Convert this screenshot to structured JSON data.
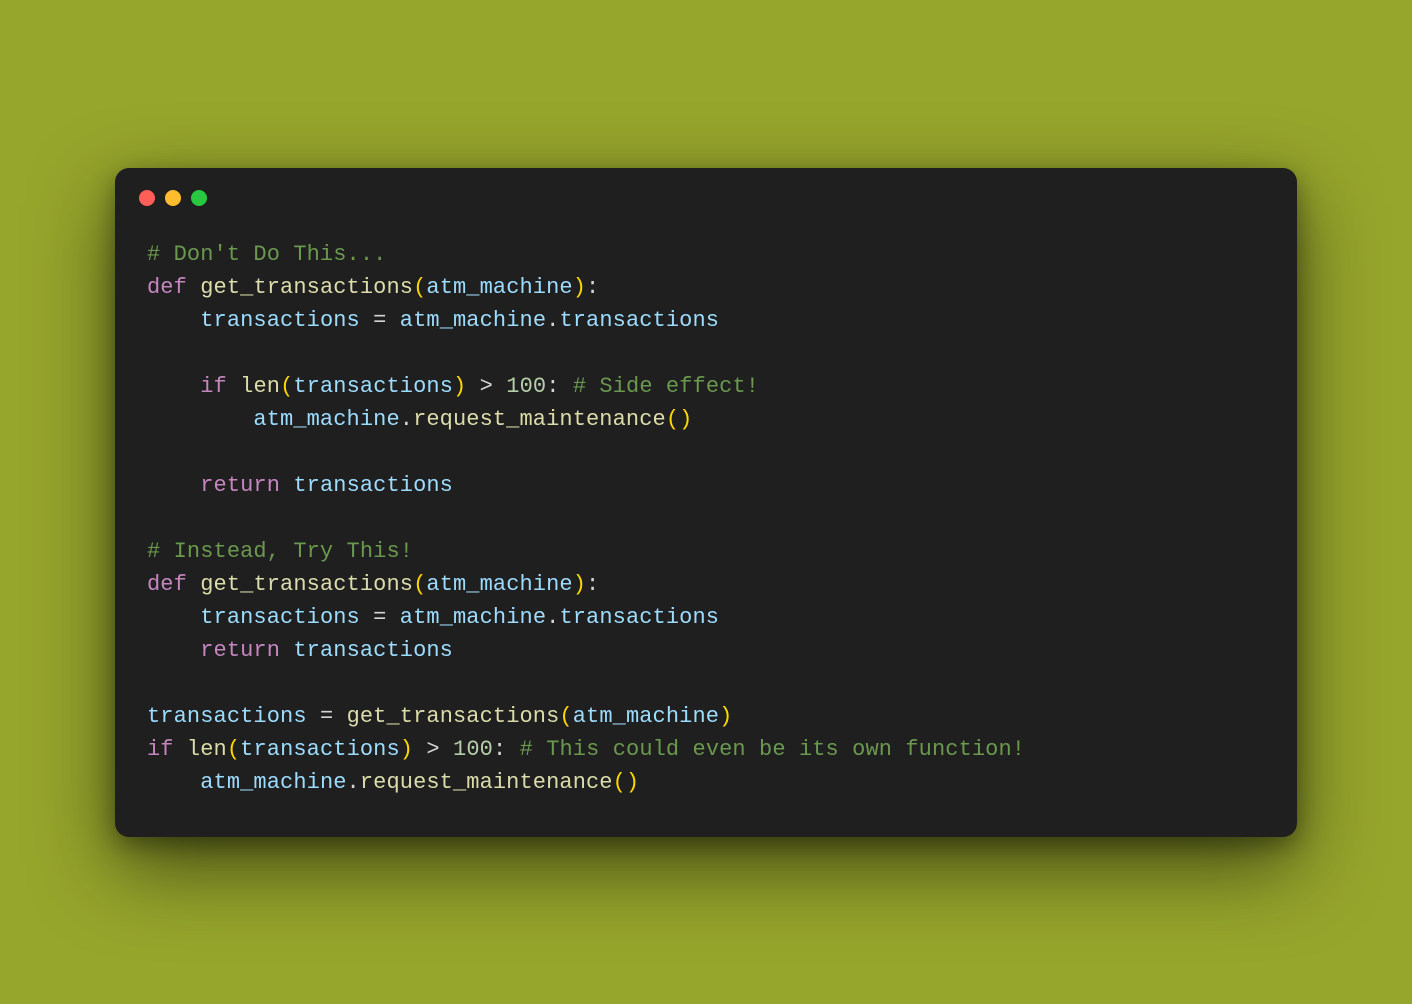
{
  "colors": {
    "background": "#96a52c",
    "card": "#1f1f1f",
    "traffic": {
      "red": "#ff5f57",
      "yellow": "#febc2e",
      "green": "#28c840"
    },
    "syntax": {
      "comment": "#6a994e",
      "keyword": "#c586c0",
      "function": "#dcdcaa",
      "identifier": "#9cdcfe",
      "operator": "#d4d4d4",
      "paren": "#ffd700",
      "number": "#b5cea8"
    }
  },
  "code_lines": [
    [
      [
        "c",
        "# Don't Do This..."
      ]
    ],
    [
      [
        "kw",
        "def"
      ],
      [
        "op",
        " "
      ],
      [
        "fn",
        "get_transactions"
      ],
      [
        "pn",
        "("
      ],
      [
        "id",
        "atm_machine"
      ],
      [
        "pn",
        ")"
      ],
      [
        "op",
        ":"
      ]
    ],
    [
      [
        "op",
        "    "
      ],
      [
        "id",
        "transactions"
      ],
      [
        "op",
        " "
      ],
      [
        "op",
        "="
      ],
      [
        "op",
        " "
      ],
      [
        "id",
        "atm_machine"
      ],
      [
        "op",
        "."
      ],
      [
        "id",
        "transactions"
      ]
    ],
    [],
    [
      [
        "op",
        "    "
      ],
      [
        "kw",
        "if"
      ],
      [
        "op",
        " "
      ],
      [
        "fn",
        "len"
      ],
      [
        "pn",
        "("
      ],
      [
        "id",
        "transactions"
      ],
      [
        "pn",
        ")"
      ],
      [
        "op",
        " "
      ],
      [
        "op",
        ">"
      ],
      [
        "op",
        " "
      ],
      [
        "num",
        "100"
      ],
      [
        "op",
        ":"
      ],
      [
        "op",
        " "
      ],
      [
        "c",
        "# Side effect!"
      ]
    ],
    [
      [
        "op",
        "        "
      ],
      [
        "id",
        "atm_machine"
      ],
      [
        "op",
        "."
      ],
      [
        "fn",
        "request_maintenance"
      ],
      [
        "pn",
        "()"
      ]
    ],
    [],
    [
      [
        "op",
        "    "
      ],
      [
        "kw",
        "return"
      ],
      [
        "op",
        " "
      ],
      [
        "id",
        "transactions"
      ]
    ],
    [],
    [
      [
        "c",
        "# Instead, Try This!"
      ]
    ],
    [
      [
        "kw",
        "def"
      ],
      [
        "op",
        " "
      ],
      [
        "fn",
        "get_transactions"
      ],
      [
        "pn",
        "("
      ],
      [
        "id",
        "atm_machine"
      ],
      [
        "pn",
        ")"
      ],
      [
        "op",
        ":"
      ]
    ],
    [
      [
        "op",
        "    "
      ],
      [
        "id",
        "transactions"
      ],
      [
        "op",
        " "
      ],
      [
        "op",
        "="
      ],
      [
        "op",
        " "
      ],
      [
        "id",
        "atm_machine"
      ],
      [
        "op",
        "."
      ],
      [
        "id",
        "transactions"
      ]
    ],
    [
      [
        "op",
        "    "
      ],
      [
        "kw",
        "return"
      ],
      [
        "op",
        " "
      ],
      [
        "id",
        "transactions"
      ]
    ],
    [],
    [
      [
        "id",
        "transactions"
      ],
      [
        "op",
        " "
      ],
      [
        "op",
        "="
      ],
      [
        "op",
        " "
      ],
      [
        "fn",
        "get_transactions"
      ],
      [
        "pn",
        "("
      ],
      [
        "id",
        "atm_machine"
      ],
      [
        "pn",
        ")"
      ]
    ],
    [
      [
        "kw",
        "if"
      ],
      [
        "op",
        " "
      ],
      [
        "fn",
        "len"
      ],
      [
        "pn",
        "("
      ],
      [
        "id",
        "transactions"
      ],
      [
        "pn",
        ")"
      ],
      [
        "op",
        " "
      ],
      [
        "op",
        ">"
      ],
      [
        "op",
        " "
      ],
      [
        "num",
        "100"
      ],
      [
        "op",
        ":"
      ],
      [
        "op",
        " "
      ],
      [
        "c",
        "# This could even be its own function!"
      ]
    ],
    [
      [
        "op",
        "    "
      ],
      [
        "id",
        "atm_machine"
      ],
      [
        "op",
        "."
      ],
      [
        "fn",
        "request_maintenance"
      ],
      [
        "pn",
        "()"
      ]
    ]
  ]
}
